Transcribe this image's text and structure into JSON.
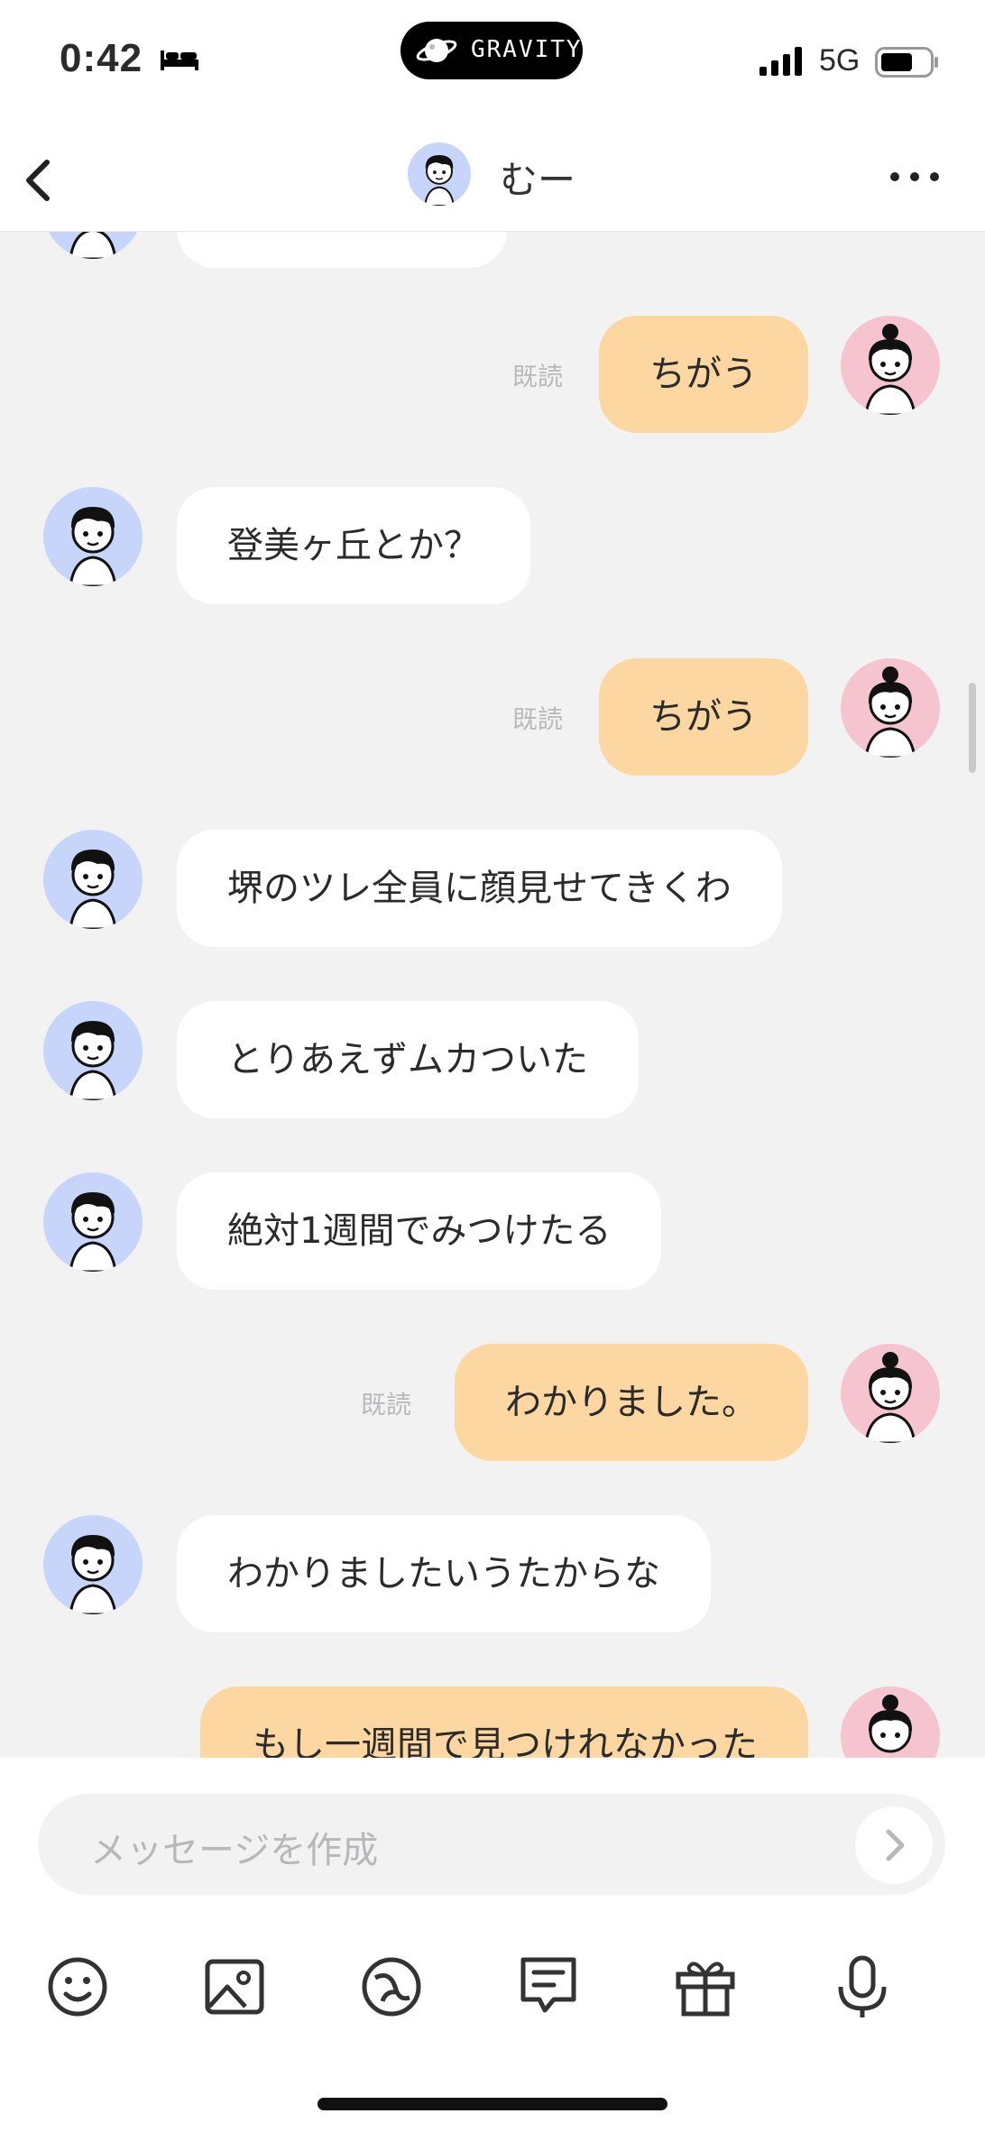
{
  "status_bar": {
    "time": "0:42",
    "island_brand": "GRAVITY",
    "network": "5G"
  },
  "header": {
    "title": "むー"
  },
  "messages": [
    {
      "text": "ちがう"
    },
    {
      "text": "登美ヶ丘とか？"
    },
    {
      "text": "ちがう"
    },
    {
      "text": "堺のツレ全員に顔見せてきくわ"
    },
    {
      "text": "とりあえずムカついた"
    },
    {
      "text": "絶対1週間でみつけたる"
    },
    {
      "text": "わかりました。"
    },
    {
      "text": "わかりましたいうたからな"
    },
    {
      "text": "もし一週間で見つけれなかった"
    }
  ],
  "read_label": "既読",
  "composer": {
    "placeholder": "メッセージを作成"
  },
  "toolbar_icons": [
    "smile-icon",
    "image-icon",
    "emoji-ball-icon",
    "chat-template-icon",
    "gift-icon",
    "microphone-icon"
  ],
  "colors": {
    "outgoing_bubble": "#fcd7a1",
    "incoming_bubble": "#ffffff",
    "background": "#f2f2f3",
    "male_avatar_bg": "#c7d5fb",
    "female_avatar_bg": "#f6c4cf"
  }
}
